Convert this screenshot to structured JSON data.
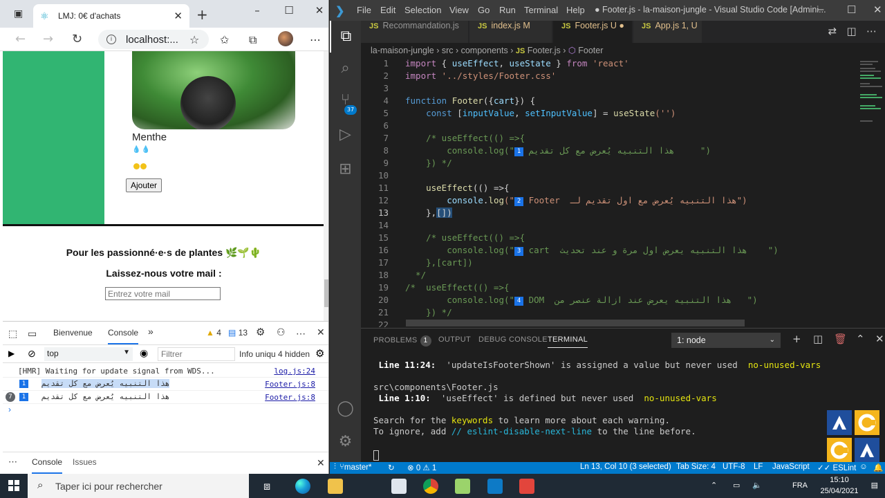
{
  "browser": {
    "tab_title": "LMJ: 0€ d'achats",
    "url": "localhost:...",
    "page": {
      "plant_name": "Menthe",
      "water_icons": "💧💧",
      "add_button": "Ajouter",
      "footer_title": "Pour les passionné·e·s de plantes",
      "footer_emojis": "🌿🌱🌵",
      "mail_label": "Laissez-nous votre mail :",
      "mail_placeholder": "Entrez votre mail"
    },
    "devtools": {
      "tabs": [
        "Bienvenue",
        "Console"
      ],
      "more": "»",
      "warn_count": "4",
      "msg_count": "13",
      "context": "top",
      "filter_placeholder": "Filtrer",
      "levels": "Info uniqu",
      "hidden": "4 hidden",
      "logs": [
        {
          "text": "[HMR] Waiting for update signal from WDS...",
          "src": "log.js:24"
        },
        {
          "badge": "1",
          "text": "هذا التنبيه يُعرض مع كل تقديم",
          "src": "Footer.js:8"
        },
        {
          "repeat": "7",
          "badge": "1",
          "text": "هذا التنبيه يُعرض مع كل تقديم",
          "src": "Footer.js:8"
        }
      ],
      "prompt": "›",
      "drawer_tabs": [
        "Console",
        "Issues"
      ]
    }
  },
  "vscode": {
    "menu": [
      "File",
      "Edit",
      "Selection",
      "View",
      "Go",
      "Run",
      "Terminal",
      "Help"
    ],
    "window_title": "● Footer.js - la-maison-jungle - Visual Studio Code [Admini...",
    "activity_badge": "37",
    "tabs": [
      {
        "name": "Recommandation.js",
        "flag": ""
      },
      {
        "name": "index.js",
        "flag": "M"
      },
      {
        "name": "Footer.js",
        "flag": "U ●"
      },
      {
        "name": "App.js",
        "flag": "1, U"
      }
    ],
    "breadcrumb": [
      "la-maison-jungle",
      "src",
      "components",
      "Footer.js",
      "Footer"
    ],
    "code": {
      "l1a": "import",
      "l1b": " { ",
      "l1c": "useEffect",
      "l1d": ", ",
      "l1e": "useState",
      "l1f": " } ",
      "l1g": "from",
      "l1h": " 'react'",
      "l2a": "import",
      "l2b": " '../styles/Footer.css'",
      "l4a": "function",
      "l4b": " Footer",
      "l4c": "({",
      "l4d": "cart",
      "l4e": "}) {",
      "l5a": "    const",
      "l5b": " [",
      "l5c": "inputValue",
      "l5d": ", ",
      "l5e": "setInputValue",
      "l5f": "] = ",
      "l5g": "useState",
      "l5h": "('')",
      "l7": "    /* useEffect(() =>{",
      "l8a": "        console.log(\"",
      "l8b": "1",
      "l8c": " هذا التنبيه يُعرض مع كل تقديم",
      "l8d": "     \")",
      "l9": "    }) */",
      "l11a": "    useEffect",
      "l11b": "(() =>{",
      "l12a": "        console",
      "l12b": ".",
      "l12c": "log",
      "l12d": "(\"",
      "l12e": "2",
      "l12f": " Footer  هذا التنبيه يُعرض مع اول تقديم لـ",
      "l12g": "\")",
      "l13a": "    },",
      "l13b": "[]",
      "l13c": ")",
      "l15": "    /* useEffect(() =>{",
      "l16a": "        console.log(\"",
      "l16b": "3",
      "l16c": " cart  هذا التنبيه يعرض اول مرة و عند تحديث",
      "l16d": "    \")",
      "l17": "    },[cart])",
      "l18": "  */",
      "l19": "/*  useEffect(() =>{",
      "l20a": "        console.log(\"",
      "l20b": "4",
      "l20c": " DOM  هذا التنبيه يعرض عند ازالة عنصر من",
      "l20d": "   \")",
      "l21": "    }) */"
    },
    "panel": {
      "tabs": [
        "PROBLEMS",
        "OUTPUT",
        "DEBUG CONSOLE",
        "TERMINAL"
      ],
      "problems_count": "1",
      "terminal_select": "1: node",
      "lines": {
        "t1a": "Line 11:24:",
        "t1b": "  'updateIsFooterShown' is assigned a value but never used  ",
        "t1c": "no-unused-vars",
        "t2": "src\\components\\Footer.js",
        "t3a": "Line 1:10:",
        "t3b": "  'useEffect' is defined but never used  ",
        "t3c": "no-unused-vars",
        "t4a": "Search for the ",
        "t4b": "keywords",
        "t4c": " to learn more about each warning.",
        "t5a": "To ignore, add ",
        "t5b": "// eslint-disable-next-line",
        "t5c": " to the line before."
      }
    },
    "status": {
      "branch": "master*",
      "errors": "⊗ 0 ⚠ 1",
      "position": "Ln 13, Col 10 (3 selected)",
      "tab_size": "Tab Size: 4",
      "encoding": "UTF-8",
      "eol": "LF",
      "language": "JavaScript",
      "eslint": "✓✓ ESLint"
    }
  },
  "taskbar": {
    "search_placeholder": "Taper ici pour rechercher",
    "lang": "FRA",
    "time": "15:10",
    "date": "25/04/2021"
  }
}
